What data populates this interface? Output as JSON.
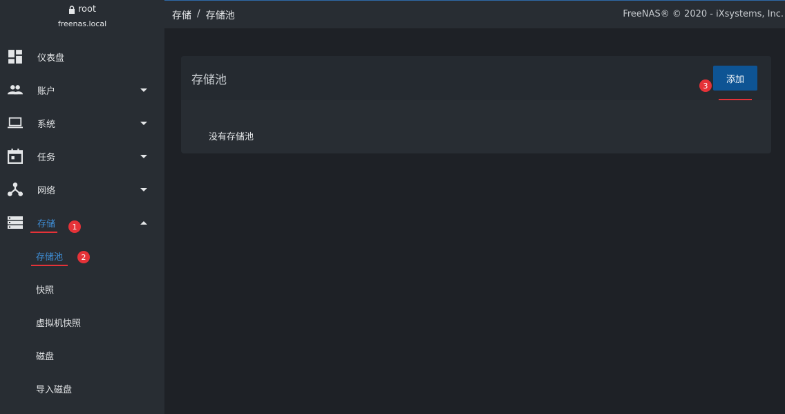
{
  "user": {
    "name": "root",
    "host": "freenas.local"
  },
  "nav": {
    "dashboard": "仪表盘",
    "accounts": "账户",
    "system": "系统",
    "tasks": "任务",
    "network": "网络",
    "storage": "存储"
  },
  "storage_sub": {
    "pools": "存储池",
    "snapshots": "快照",
    "vm_snapshots": "虚拟机快照",
    "disks": "磁盘",
    "import_disk": "导入磁盘"
  },
  "breadcrumb": {
    "first": "存储",
    "sep": "/",
    "second": "存储池"
  },
  "copyright": "FreeNAS® © 2020 - iXsystems, Inc.",
  "card": {
    "title": "存储池",
    "add_label": "添加",
    "empty_text": "没有存储池"
  },
  "annotations": {
    "badge1": "1",
    "badge2": "2",
    "badge3": "3"
  },
  "colors": {
    "accent_blue": "#0e5494",
    "active_text": "#3f8fd8",
    "annotation_red": "#e53238",
    "sidebar_bg": "#282d33",
    "page_bg": "#1e2126"
  }
}
